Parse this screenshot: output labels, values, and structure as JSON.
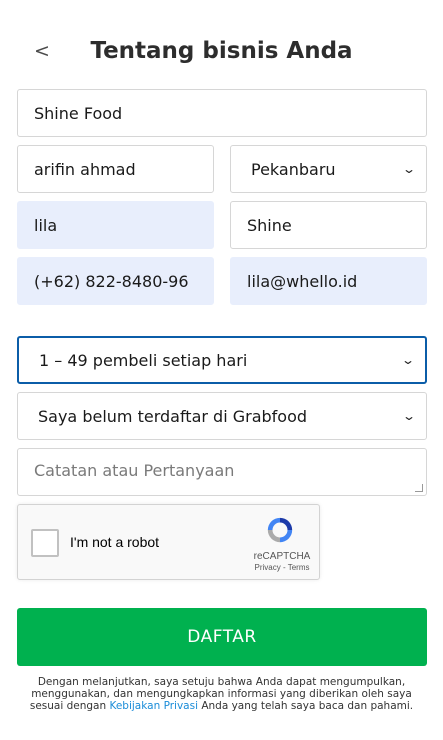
{
  "header": {
    "back_label": "<",
    "title": "Tentang bisnis Anda"
  },
  "form": {
    "business_name": "Shine Food",
    "owner_name": "arifin ahmad",
    "city": "Pekanbaru",
    "first_name": "lila",
    "last_name": "Shine",
    "phone": "(+62) 822-8480-96",
    "email": "lila@whello.id",
    "buyers_per_day": "1 – 49 pembeli setiap hari",
    "grabfood_status": "Saya belum terdaftar di Grabfood",
    "notes_placeholder": "Catatan atau Pertanyaan"
  },
  "captcha": {
    "label": "I'm not a robot",
    "brand": "reCAPTCHA",
    "privacy": "Privacy",
    "separator": " - ",
    "terms": "Terms"
  },
  "submit_label": "DAFTAR",
  "disclaimer": {
    "before": "Dengan melanjutkan, saya setuju bahwa Anda dapat mengumpulkan, menggunakan, dan mengungkapkan informasi yang diberikan oleh saya sesuai dengan ",
    "link": "Kebijakan Privasi",
    "after": " Anda yang telah saya baca dan pahami."
  },
  "colors": {
    "accent": "#00b14f",
    "filled_bg": "#e8eefc",
    "focus_border": "#0b5da8",
    "link": "#1a8cd8"
  },
  "icons": {
    "back": "chevron-left-icon",
    "dropdown": "chevron-down-icon",
    "captcha": "recaptcha-logo-icon"
  }
}
